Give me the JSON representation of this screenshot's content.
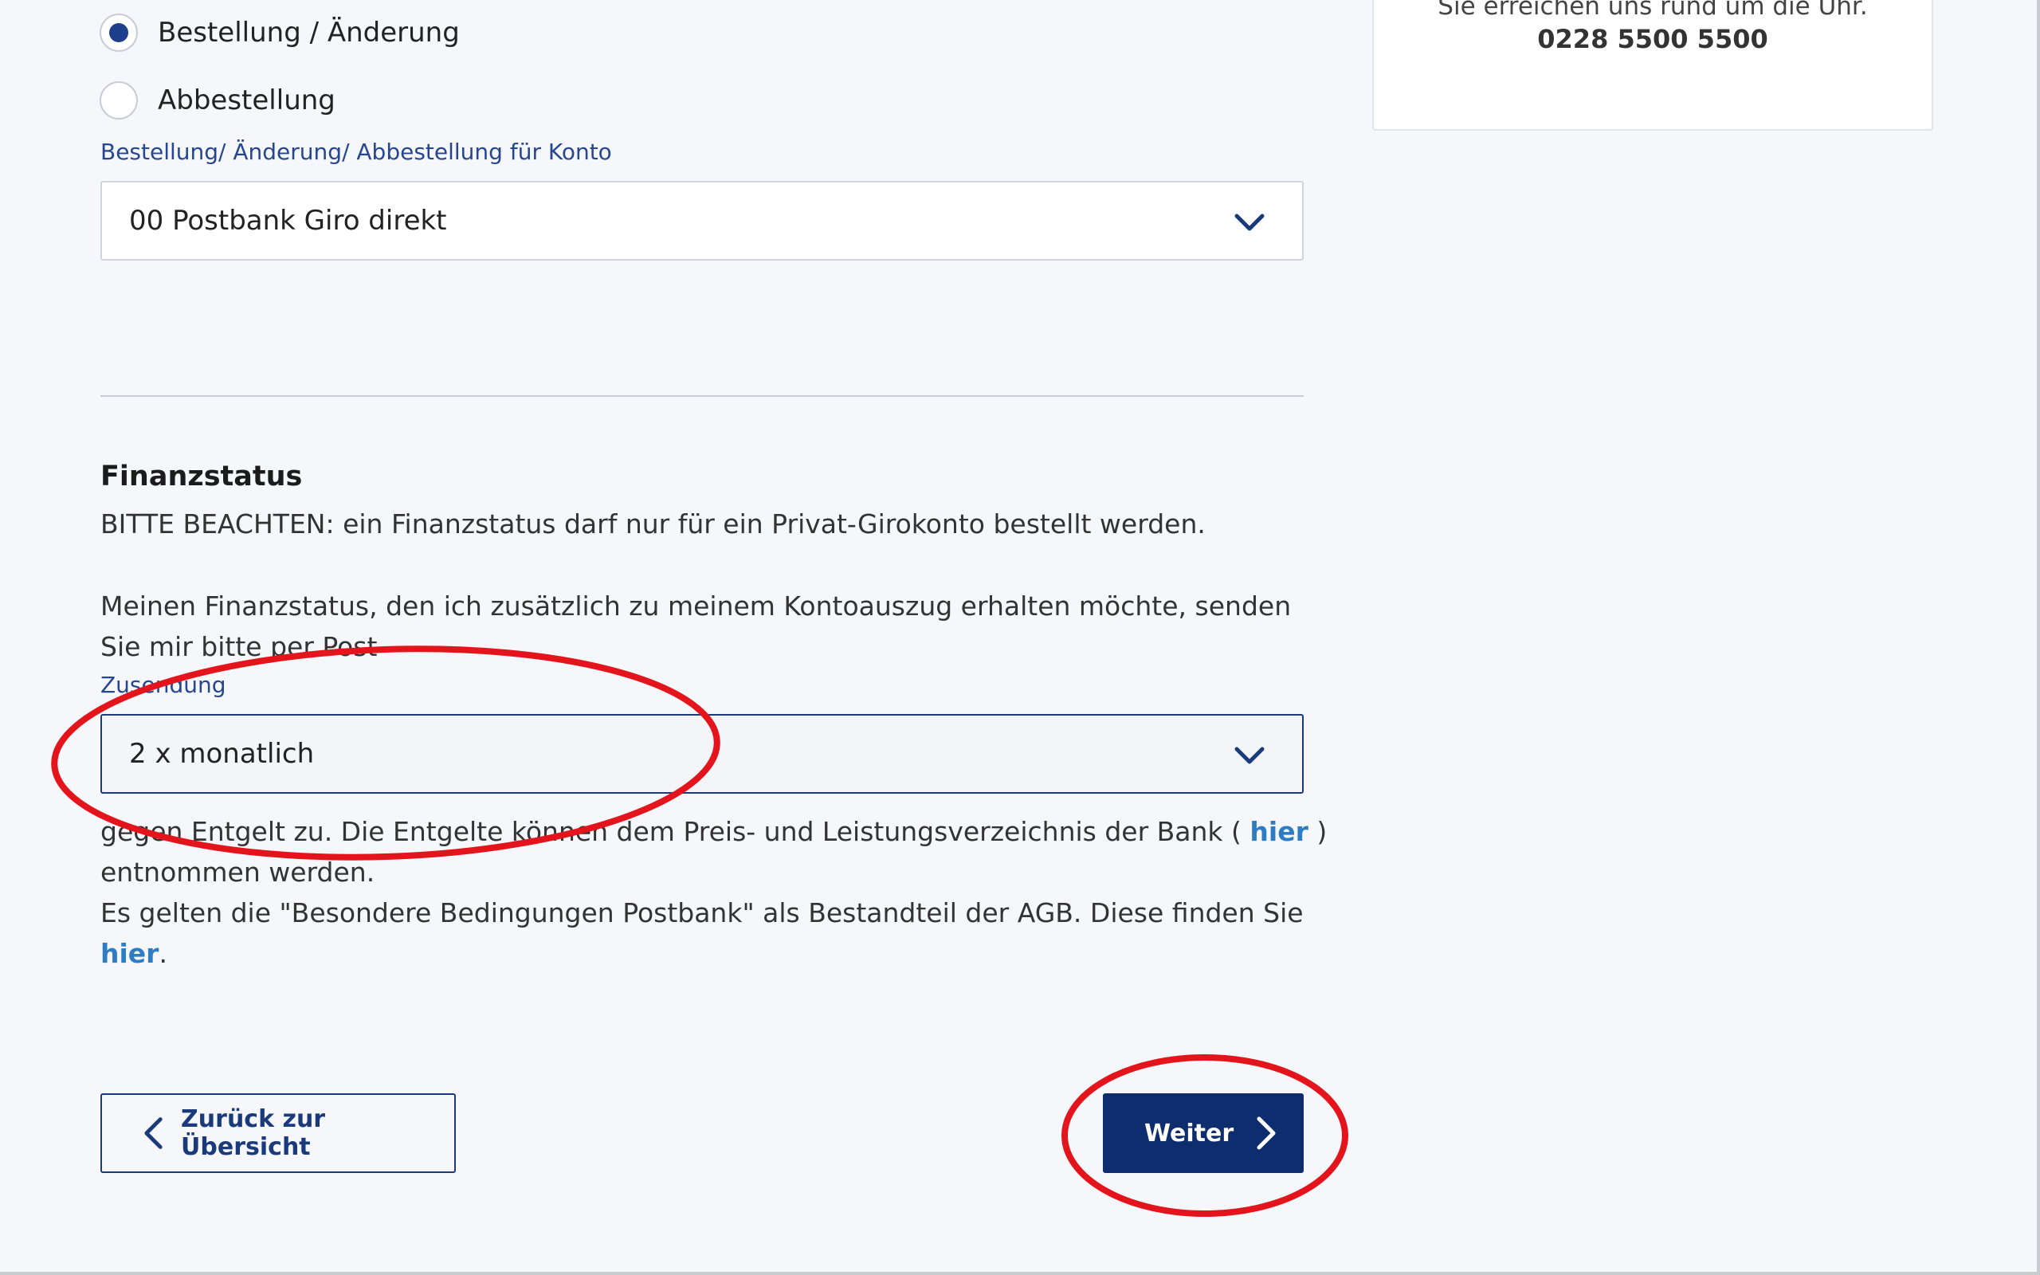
{
  "order_type": {
    "options": [
      {
        "label": "Bestellung / Änderung",
        "selected": true
      },
      {
        "label": "Abbestellung",
        "selected": false
      }
    ]
  },
  "account_field": {
    "label": "Bestellung/ Änderung/ Abbestellung für Konto",
    "value": "00 Postbank Giro direkt"
  },
  "help": {
    "text": "Sie erreichen uns rund um die Uhr.",
    "phone": "0228 5500 5500"
  },
  "finanzstatus": {
    "heading": "Finanzstatus",
    "note": "BITTE BEACHTEN: ein Finanzstatus darf nur für ein Privat-Girokonto bestellt werden.",
    "intro": "Meinen Finanzstatus, den ich zusätzlich zu meinem Kontoauszug erhalten möchte, senden Sie mir bitte per Post",
    "delivery_label": "Zusendung",
    "delivery_value": "2 x monatlich",
    "fee_text": "gegen Entgelt zu. Die Entgelte können dem Preis- und Leistungsverzeichnis der Bank (",
    "fee_link": "hier",
    "fee_text_end": ") entnommen werden.",
    "terms_text": "Es gelten die \"Besondere Bedingungen Postbank\" als Bestandteil der AGB. Diese finden Sie",
    "terms_link": "hier",
    "terms_end": "."
  },
  "buttons": {
    "back": "Zurück zur Übersicht",
    "next": "Weiter"
  },
  "colors": {
    "accent": "#0e2d6e",
    "link": "#2e7dc4",
    "label": "#26478f",
    "annotation": "#e3141c"
  }
}
